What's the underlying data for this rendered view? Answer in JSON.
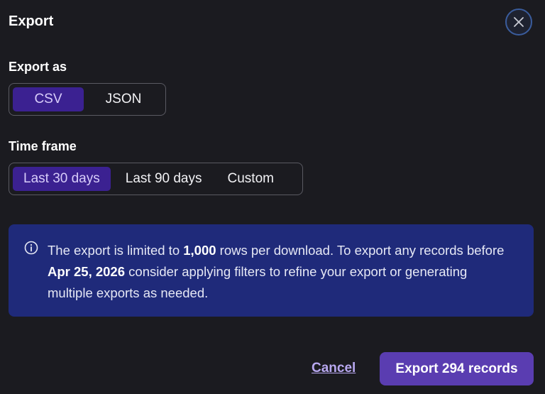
{
  "dialog": {
    "title": "Export",
    "close_icon": "close-icon"
  },
  "export_as": {
    "label": "Export as",
    "options": [
      "CSV",
      "JSON"
    ],
    "selected": "CSV"
  },
  "time_frame": {
    "label": "Time frame",
    "options": [
      "Last 30 days",
      "Last 90 days",
      "Custom"
    ],
    "selected": "Last 30 days"
  },
  "info_banner": {
    "icon": "info-icon",
    "part1": "The export is limited to ",
    "limit": "1,000",
    "part2": " rows per download. To export any records before ",
    "date": "Apr 25, 2026",
    "part3": " consider applying filters to refine your export or generating multiple exports as needed."
  },
  "actions": {
    "cancel_label": "Cancel",
    "export_label": "Export 294 records"
  },
  "colors": {
    "background": "#1b1b20",
    "selected_segment": "#3b2191",
    "info_banner": "#1f2a7a",
    "primary_button": "#5a3db1",
    "link": "#b8a8f0"
  }
}
